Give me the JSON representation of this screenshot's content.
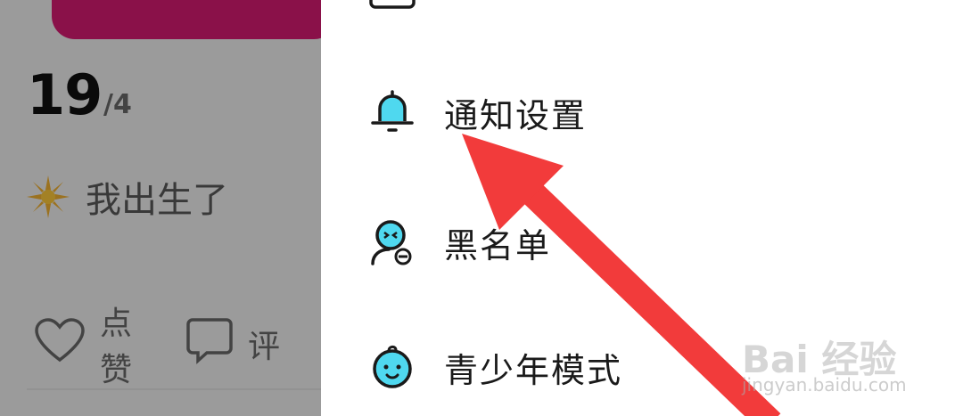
{
  "feed": {
    "date_day": "19",
    "date_month": "/4",
    "post_text": "我出生了",
    "like_label": "点赞",
    "comment_label": "评"
  },
  "menu": {
    "items": [
      {
        "label": "",
        "icon": "folder-icon"
      },
      {
        "label": "通知设置",
        "icon": "bell-icon"
      },
      {
        "label": "黑名单",
        "icon": "block-user-icon"
      },
      {
        "label": "青少年模式",
        "icon": "baby-face-icon"
      }
    ]
  },
  "watermark": {
    "logo": "Bai 经验",
    "url": "jingyan.baidu.com"
  },
  "colors": {
    "accent_pink": "#d81b72",
    "icon_cyan": "#4fd8ef",
    "arrow_red": "#f23b3b"
  }
}
